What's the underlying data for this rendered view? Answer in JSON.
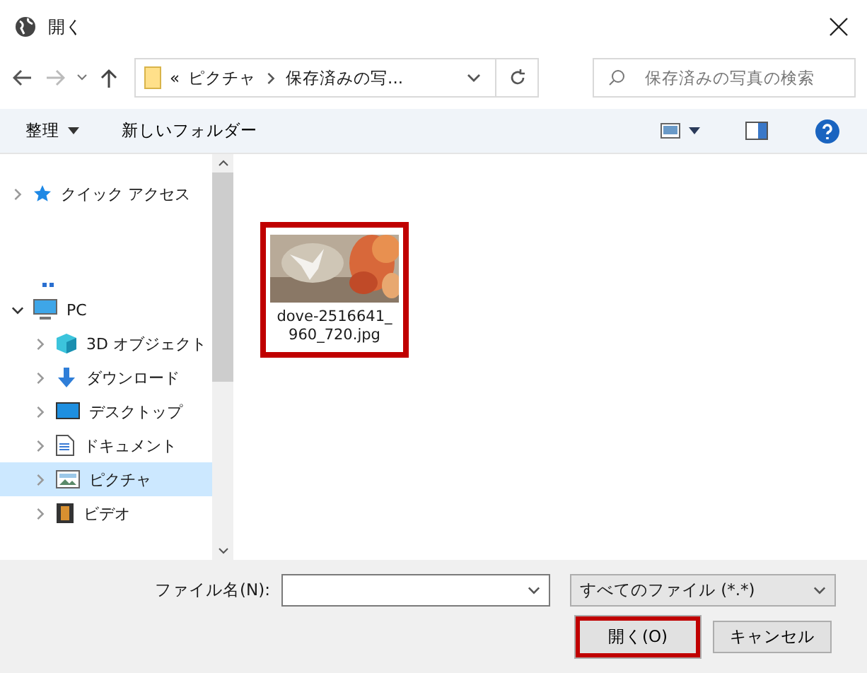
{
  "window": {
    "title": "開く"
  },
  "address": {
    "overflow": "«",
    "path": [
      {
        "label": "ピクチャ"
      },
      {
        "label": "保存済みの写..."
      }
    ]
  },
  "search": {
    "placeholder": "保存済みの写真の検索"
  },
  "toolbar": {
    "organize": "整理",
    "new_folder": "新しいフォルダー"
  },
  "nav": [
    {
      "label": "クイック アクセス",
      "kind": "quick",
      "expanded": false,
      "selected": false
    },
    {
      "label": "PC",
      "kind": "pc",
      "expanded": true,
      "selected": false,
      "children": [
        {
          "label": "3D オブジェクト",
          "kind": "cube",
          "expanded": false,
          "selected": false
        },
        {
          "label": "ダウンロード",
          "kind": "download",
          "expanded": false,
          "selected": false
        },
        {
          "label": "デスクトップ",
          "kind": "desktop",
          "expanded": false,
          "selected": false
        },
        {
          "label": "ドキュメント",
          "kind": "document",
          "expanded": false,
          "selected": false
        },
        {
          "label": "ピクチャ",
          "kind": "picture",
          "expanded": false,
          "selected": true
        },
        {
          "label": "ビデオ",
          "kind": "video",
          "expanded": false,
          "selected": false
        }
      ]
    }
  ],
  "files": [
    {
      "name": "dove-2516641_960_720.jpg",
      "highlighted": true
    }
  ],
  "filename": {
    "label": "ファイル名(N):"
  },
  "filetype": {
    "value": "すべてのファイル (*.*)"
  },
  "buttons": [
    {
      "label": "開く(O)",
      "highlighted": true
    },
    {
      "label": "キャンセル",
      "highlighted": false
    }
  ]
}
